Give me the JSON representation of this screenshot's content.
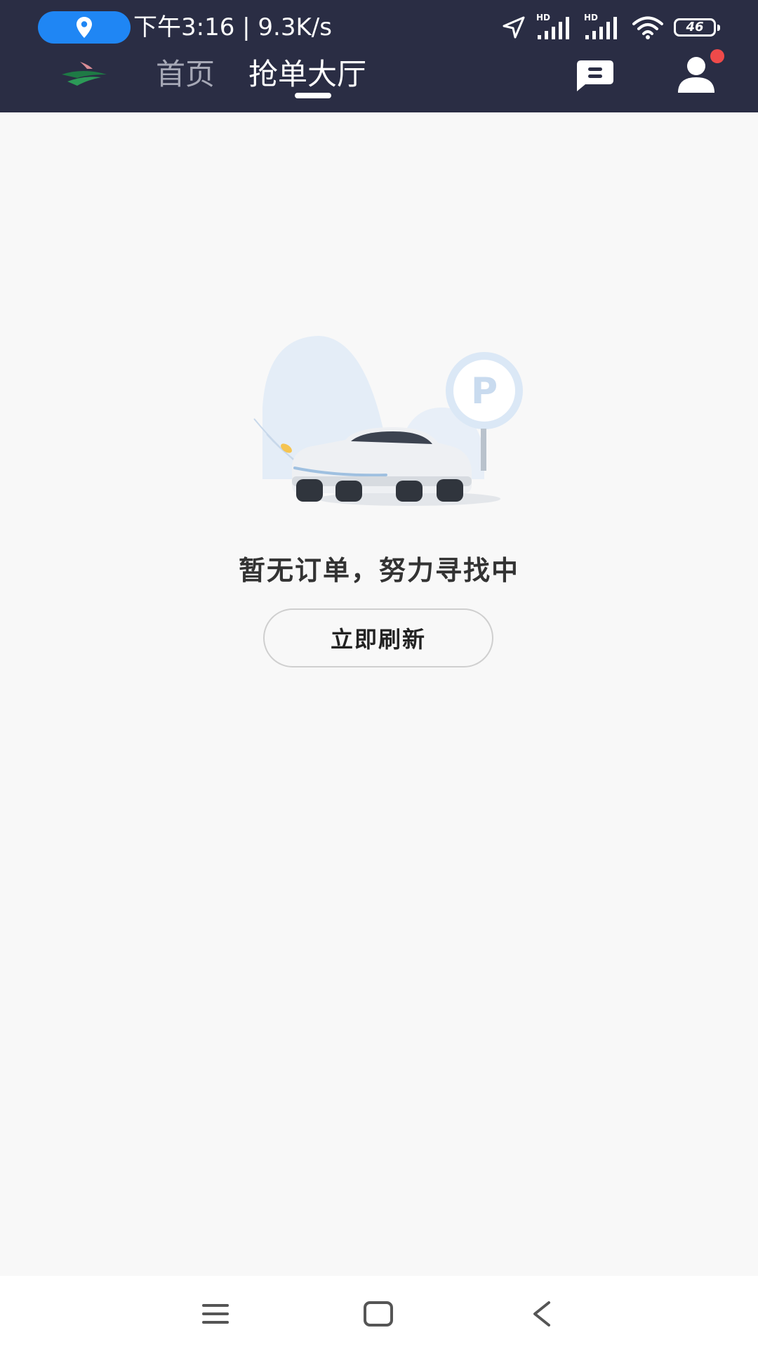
{
  "status_bar": {
    "time_speed": "下午3:16 | 9.3K/s",
    "signal1_label": "HD",
    "signal2_label": "HD",
    "battery_level": "46",
    "icons": [
      "location-pin-icon",
      "navigation-arrow-icon",
      "signal-hd-icon",
      "signal-hd-icon",
      "wifi-icon",
      "battery-icon"
    ]
  },
  "nav": {
    "tabs": [
      {
        "label": "首页",
        "active": false
      },
      {
        "label": "抢单大厅",
        "active": true
      }
    ],
    "icons": [
      "app-logo-icon",
      "message-icon",
      "profile-icon"
    ],
    "notification_dot": true,
    "colors": {
      "header_bg": "#2a2d44",
      "inactive_tab": "#a6a8b6",
      "active_tab": "#ffffff",
      "notification_dot": "#ef4a4a"
    }
  },
  "empty_state": {
    "message": "暂无订单，努力寻找中",
    "refresh_label": "立即刷新",
    "illustration": "car-parking-illustration"
  },
  "system_nav": {
    "icons": [
      "menu-icon",
      "home-square-icon",
      "back-chevron-icon"
    ]
  }
}
